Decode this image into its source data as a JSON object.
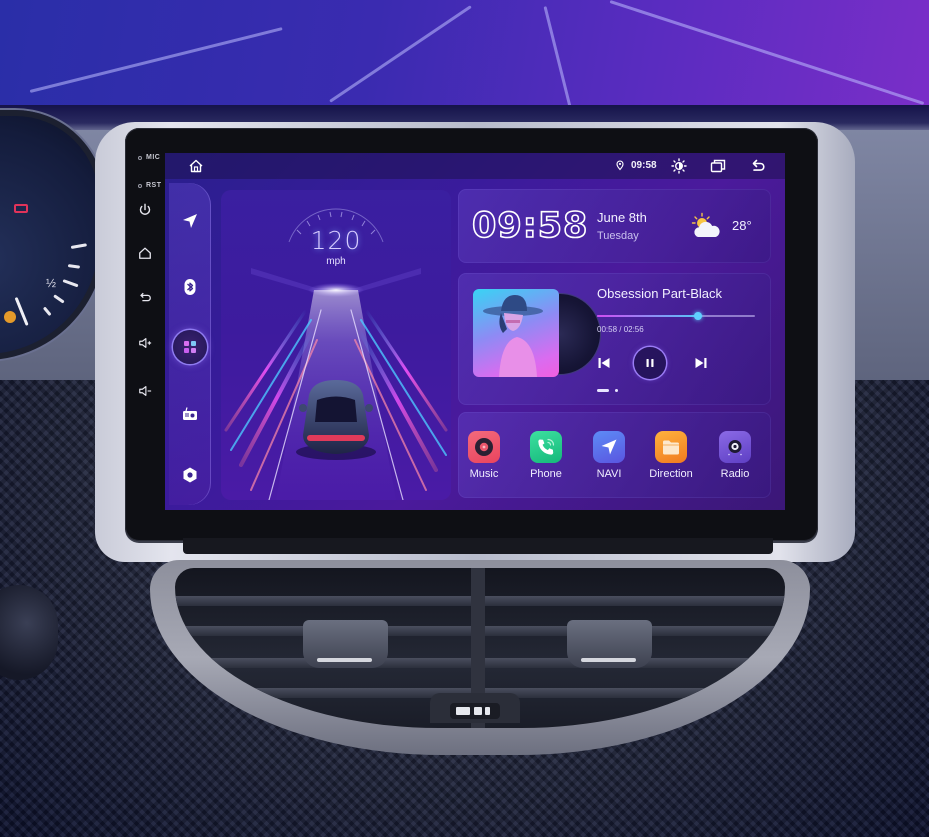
{
  "hardware": {
    "labels": {
      "mic": "MIC",
      "rst": "RST"
    },
    "buttons": [
      {
        "name": "power",
        "icon": "power-icon"
      },
      {
        "name": "home",
        "icon": "home-icon"
      },
      {
        "name": "back",
        "icon": "back-icon"
      },
      {
        "name": "volume-up",
        "icon": "volume-up-icon"
      },
      {
        "name": "volume-down",
        "icon": "volume-down-icon"
      }
    ]
  },
  "statusbar": {
    "home_icon": "home-icon",
    "location_icon": "location-pin-icon",
    "time": "09:58",
    "brightness_icon": "brightness-icon",
    "recent_apps_icon": "recent-apps-icon",
    "back_icon": "back-icon"
  },
  "dock": {
    "items": [
      {
        "name": "navigation",
        "icon": "navigation-arrow-icon"
      },
      {
        "name": "bluetooth",
        "icon": "bluetooth-icon"
      },
      {
        "name": "apps",
        "icon": "app-grid-icon",
        "active": true
      },
      {
        "name": "radio",
        "icon": "radio-icon"
      },
      {
        "name": "settings",
        "icon": "settings-icon"
      }
    ]
  },
  "speedometer": {
    "speed": "120",
    "unit": "mph"
  },
  "clock_widget": {
    "time": "09:58",
    "date": "June 8th",
    "weekday": "Tuesday",
    "weather_icon": "partly-cloudy-icon",
    "temperature": "28°"
  },
  "music_widget": {
    "title": "Obsession Part-Black",
    "elapsed": "00:58",
    "duration": "02:56",
    "time_display": "00:58 / 02:56",
    "progress": 0.64,
    "state": "playing",
    "page_index": 0,
    "page_count": 2
  },
  "apps": [
    {
      "label": "Music",
      "icon": "music-disc-icon",
      "color": "#f0566e"
    },
    {
      "label": "Phone",
      "icon": "phone-icon",
      "color": "#22c98a"
    },
    {
      "label": "NAVI",
      "icon": "navigation-arrow-icon",
      "color": "#4f73f0"
    },
    {
      "label": "Direction",
      "icon": "folder-icon",
      "color": "#f59a2c"
    },
    {
      "label": "Radio",
      "icon": "radio-speaker-icon",
      "color": "#7654d8"
    }
  ],
  "colors": {
    "screen_bg": "#3a1b9c",
    "accent_cyan": "#55c6f7",
    "accent_magenta": "#d14cf2"
  }
}
